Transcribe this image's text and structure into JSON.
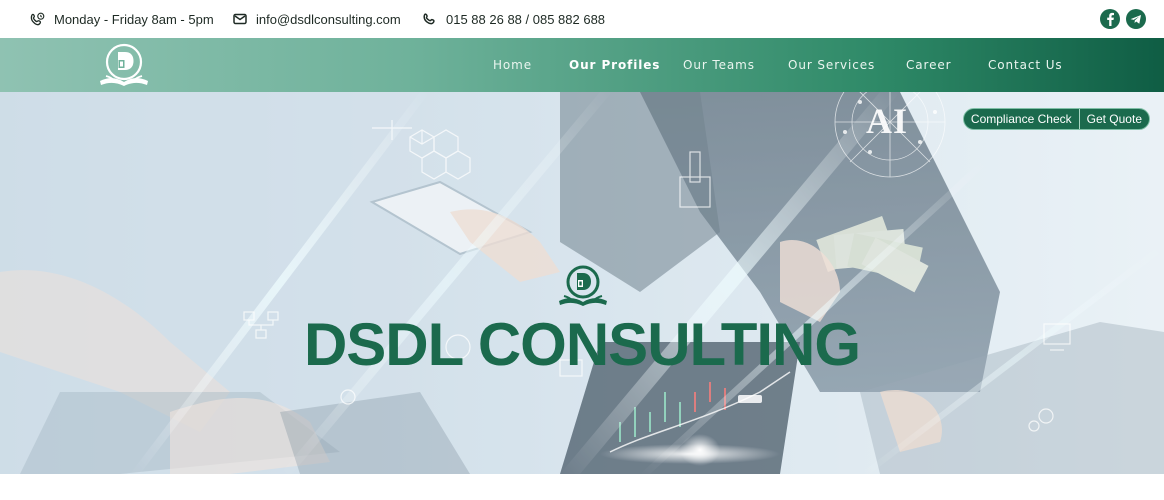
{
  "topbar": {
    "hours": "Monday - Friday 8am - 5pm",
    "email": "info@dsdlconsulting.com",
    "phone": "015 88 26 88 / 085 882 688",
    "social": [
      {
        "icon": "facebook-icon"
      },
      {
        "icon": "telegram-icon"
      }
    ]
  },
  "nav": {
    "items": [
      {
        "label": "Home"
      },
      {
        "label": "Our Profiles",
        "active": true
      },
      {
        "label": "Our Teams"
      },
      {
        "label": "Our Services"
      },
      {
        "label": "Career"
      },
      {
        "label": "Contact Us"
      }
    ]
  },
  "hero": {
    "title": "DSDL CONSULTING",
    "ai_label": "AI",
    "buttons": {
      "compliance": "Compliance Check",
      "quote": "Get Quote"
    }
  },
  "colors": {
    "brand_green": "#1b6a4d",
    "nav_gradient_start": "#8fc2b2",
    "nav_gradient_end": "#0f5d44"
  }
}
